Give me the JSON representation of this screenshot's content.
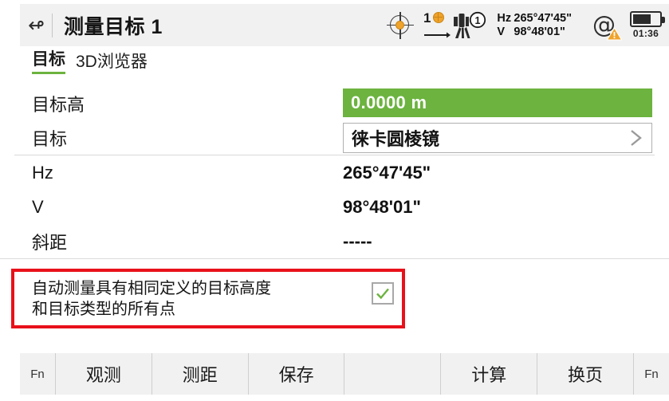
{
  "header": {
    "back_icon": "back-arrow-icon",
    "title": "测量目标 1",
    "status": {
      "reticle_icon": "crosshair-target-icon",
      "prism_count": "1",
      "prism_icon": "prism-icon",
      "station_icon": "total-station-icon",
      "station_number": "1",
      "hz_label": "Hz",
      "hz_value": "265°47'45\"",
      "v_label": "V",
      "v_value": "98°48'01\"",
      "connection_icon": "at-symbol-warning-icon",
      "battery_icon": "battery-icon",
      "battery_level_percent": 70,
      "battery_time": "01:36"
    }
  },
  "tabs": [
    {
      "label": "目标",
      "active": true
    },
    {
      "label": "3D浏览器",
      "active": false
    }
  ],
  "form": {
    "rows": [
      {
        "label": "目标高",
        "value": "0.0000 m",
        "type": "green-field"
      },
      {
        "label": "目标",
        "value": "徕卡圆棱镜",
        "type": "select"
      },
      {
        "label": "Hz",
        "value": "265°47'45\"",
        "type": "text"
      },
      {
        "label": "V",
        "value": "98°48'01\"",
        "type": "text"
      },
      {
        "label": "斜距",
        "value": "-----",
        "type": "text"
      }
    ]
  },
  "auto_measure": {
    "label": "自动测量具有相同定义的目标高度\n和目标类型的所有点",
    "checked": true,
    "highlight_color": "#e8111a"
  },
  "footer": {
    "buttons": [
      {
        "label": "Fn",
        "kind": "fn"
      },
      {
        "label": "观测",
        "kind": "wide"
      },
      {
        "label": "测距",
        "kind": "wide"
      },
      {
        "label": "保存",
        "kind": "wide"
      },
      {
        "label": "",
        "kind": "spacer"
      },
      {
        "label": "计算",
        "kind": "wide"
      },
      {
        "label": "换页",
        "kind": "wide"
      },
      {
        "label": "Fn",
        "kind": "fn-last"
      }
    ]
  },
  "colors": {
    "accent_green": "#6cb33f",
    "alert_red": "#e8111a",
    "prism_orange": "#f0a32a",
    "bar_gray": "#f1f1f1"
  }
}
